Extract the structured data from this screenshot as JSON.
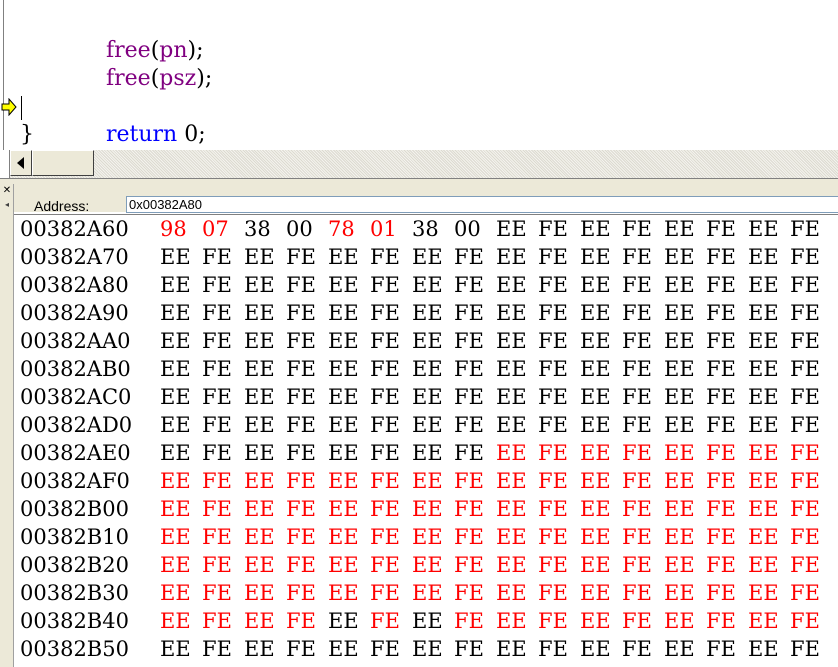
{
  "editor": {
    "lines": [
      {
        "fn": "free",
        "arg": "pn"
      },
      {
        "fn": "free",
        "arg": "psz"
      }
    ],
    "return_keyword": "return",
    "return_value": "0",
    "closing_brace": "}"
  },
  "memory": {
    "address_label": "Address:",
    "address_value": "0x00382A80",
    "colors": {
      "changed": "#ff0000",
      "normal": "#000000"
    },
    "rows": [
      {
        "address": "00382A60",
        "bytes": [
          "98",
          "07",
          "38",
          "00",
          "78",
          "01",
          "38",
          "00",
          "EE",
          "FE",
          "EE",
          "FE",
          "EE",
          "FE",
          "EE",
          "FE"
        ],
        "changed": [
          0,
          1,
          4,
          5
        ]
      },
      {
        "address": "00382A70",
        "bytes": [
          "EE",
          "FE",
          "EE",
          "FE",
          "EE",
          "FE",
          "EE",
          "FE",
          "EE",
          "FE",
          "EE",
          "FE",
          "EE",
          "FE",
          "EE",
          "FE"
        ],
        "changed": []
      },
      {
        "address": "00382A80",
        "bytes": [
          "EE",
          "FE",
          "EE",
          "FE",
          "EE",
          "FE",
          "EE",
          "FE",
          "EE",
          "FE",
          "EE",
          "FE",
          "EE",
          "FE",
          "EE",
          "FE"
        ],
        "changed": []
      },
      {
        "address": "00382A90",
        "bytes": [
          "EE",
          "FE",
          "EE",
          "FE",
          "EE",
          "FE",
          "EE",
          "FE",
          "EE",
          "FE",
          "EE",
          "FE",
          "EE",
          "FE",
          "EE",
          "FE"
        ],
        "changed": []
      },
      {
        "address": "00382AA0",
        "bytes": [
          "EE",
          "FE",
          "EE",
          "FE",
          "EE",
          "FE",
          "EE",
          "FE",
          "EE",
          "FE",
          "EE",
          "FE",
          "EE",
          "FE",
          "EE",
          "FE"
        ],
        "changed": []
      },
      {
        "address": "00382AB0",
        "bytes": [
          "EE",
          "FE",
          "EE",
          "FE",
          "EE",
          "FE",
          "EE",
          "FE",
          "EE",
          "FE",
          "EE",
          "FE",
          "EE",
          "FE",
          "EE",
          "FE"
        ],
        "changed": []
      },
      {
        "address": "00382AC0",
        "bytes": [
          "EE",
          "FE",
          "EE",
          "FE",
          "EE",
          "FE",
          "EE",
          "FE",
          "EE",
          "FE",
          "EE",
          "FE",
          "EE",
          "FE",
          "EE",
          "FE"
        ],
        "changed": []
      },
      {
        "address": "00382AD0",
        "bytes": [
          "EE",
          "FE",
          "EE",
          "FE",
          "EE",
          "FE",
          "EE",
          "FE",
          "EE",
          "FE",
          "EE",
          "FE",
          "EE",
          "FE",
          "EE",
          "FE"
        ],
        "changed": []
      },
      {
        "address": "00382AE0",
        "bytes": [
          "EE",
          "FE",
          "EE",
          "FE",
          "EE",
          "FE",
          "EE",
          "FE",
          "EE",
          "FE",
          "EE",
          "FE",
          "EE",
          "FE",
          "EE",
          "FE"
        ],
        "changed": [
          8,
          9,
          10,
          11,
          12,
          13,
          14,
          15
        ]
      },
      {
        "address": "00382AF0",
        "bytes": [
          "EE",
          "FE",
          "EE",
          "FE",
          "EE",
          "FE",
          "EE",
          "FE",
          "EE",
          "FE",
          "EE",
          "FE",
          "EE",
          "FE",
          "EE",
          "FE"
        ],
        "changed": [
          0,
          1,
          2,
          3,
          4,
          5,
          6,
          7,
          8,
          9,
          10,
          11,
          12,
          13,
          14,
          15
        ]
      },
      {
        "address": "00382B00",
        "bytes": [
          "EE",
          "FE",
          "EE",
          "FE",
          "EE",
          "FE",
          "EE",
          "FE",
          "EE",
          "FE",
          "EE",
          "FE",
          "EE",
          "FE",
          "EE",
          "FE"
        ],
        "changed": [
          0,
          1,
          2,
          3,
          4,
          5,
          6,
          7,
          8,
          9,
          10,
          11,
          12,
          13,
          14,
          15
        ]
      },
      {
        "address": "00382B10",
        "bytes": [
          "EE",
          "FE",
          "EE",
          "FE",
          "EE",
          "FE",
          "EE",
          "FE",
          "EE",
          "FE",
          "EE",
          "FE",
          "EE",
          "FE",
          "EE",
          "FE"
        ],
        "changed": [
          0,
          1,
          2,
          3,
          4,
          5,
          6,
          7,
          8,
          9,
          10,
          11,
          12,
          13,
          14,
          15
        ]
      },
      {
        "address": "00382B20",
        "bytes": [
          "EE",
          "FE",
          "EE",
          "FE",
          "EE",
          "FE",
          "EE",
          "FE",
          "EE",
          "FE",
          "EE",
          "FE",
          "EE",
          "FE",
          "EE",
          "FE"
        ],
        "changed": [
          0,
          1,
          2,
          3,
          4,
          5,
          6,
          7,
          8,
          9,
          10,
          11,
          12,
          13,
          14,
          15
        ]
      },
      {
        "address": "00382B30",
        "bytes": [
          "EE",
          "FE",
          "EE",
          "FE",
          "EE",
          "FE",
          "EE",
          "FE",
          "EE",
          "FE",
          "EE",
          "FE",
          "EE",
          "FE",
          "EE",
          "FE"
        ],
        "changed": [
          0,
          1,
          2,
          3,
          4,
          5,
          6,
          7,
          8,
          9,
          10,
          11,
          12,
          13,
          14,
          15
        ]
      },
      {
        "address": "00382B40",
        "bytes": [
          "EE",
          "FE",
          "EE",
          "FE",
          "EE",
          "FE",
          "EE",
          "FE",
          "EE",
          "FE",
          "EE",
          "FE",
          "EE",
          "FE",
          "EE",
          "FE"
        ],
        "changed": [
          0,
          1,
          2,
          3,
          5,
          7,
          8,
          9,
          10,
          11,
          12,
          13,
          14,
          15
        ]
      },
      {
        "address": "00382B50",
        "bytes": [
          "EE",
          "FE",
          "EE",
          "FE",
          "EE",
          "FE",
          "EE",
          "FE",
          "EE",
          "FE",
          "EE",
          "FE",
          "EE",
          "FE",
          "EE",
          "FE"
        ],
        "changed": []
      }
    ]
  },
  "icons": {
    "exec_arrow": "current-statement-arrow-icon",
    "close": "close-icon",
    "scroll_left": "scroll-left-arrow-icon"
  },
  "window_controls": {
    "close_glyph": "✕",
    "collapse_glyph": "◂"
  }
}
